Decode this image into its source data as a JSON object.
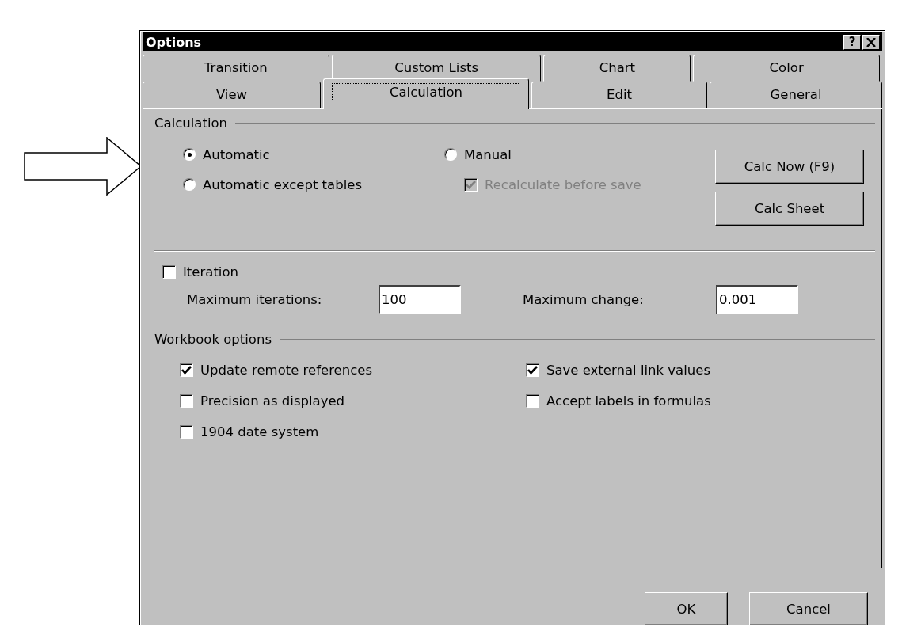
{
  "window": {
    "title": "Options",
    "help_button": "?"
  },
  "tab_rows": [
    [
      {
        "label": "Transition",
        "selected": false
      },
      {
        "label": "Custom Lists",
        "selected": false
      },
      {
        "label": "Chart",
        "selected": false
      },
      {
        "label": "Color",
        "selected": false
      }
    ],
    [
      {
        "label": "View",
        "selected": false
      },
      {
        "label": "Calculation",
        "selected": true
      },
      {
        "label": "Edit",
        "selected": false
      },
      {
        "label": "General",
        "selected": false
      }
    ]
  ],
  "calculation": {
    "title": "Calculation",
    "modes": [
      {
        "label": "Automatic",
        "selected": true
      },
      {
        "label": "Automatic except tables",
        "selected": false
      },
      {
        "label": "Manual",
        "selected": false
      }
    ],
    "recalculate_before_save": {
      "label": "Recalculate before save",
      "checked": true,
      "disabled": true
    },
    "buttons": [
      "Calc Now (F9)",
      "Calc Sheet"
    ]
  },
  "iteration": {
    "label": "Iteration",
    "checked": false,
    "max_iterations": {
      "label": "Maximum iterations:",
      "value": "100"
    },
    "max_change": {
      "label": "Maximum change:",
      "value": "0.001"
    }
  },
  "workbook_options": {
    "title": "Workbook options",
    "options": [
      {
        "label": "Update remote references",
        "checked": true
      },
      {
        "label": "Save external link values",
        "checked": true
      },
      {
        "label": "Precision as displayed",
        "checked": false
      },
      {
        "label": "Accept labels in formulas",
        "checked": false
      },
      {
        "label": "1904 date system",
        "checked": false
      }
    ]
  },
  "dialog_buttons": [
    "OK",
    "Cancel"
  ]
}
